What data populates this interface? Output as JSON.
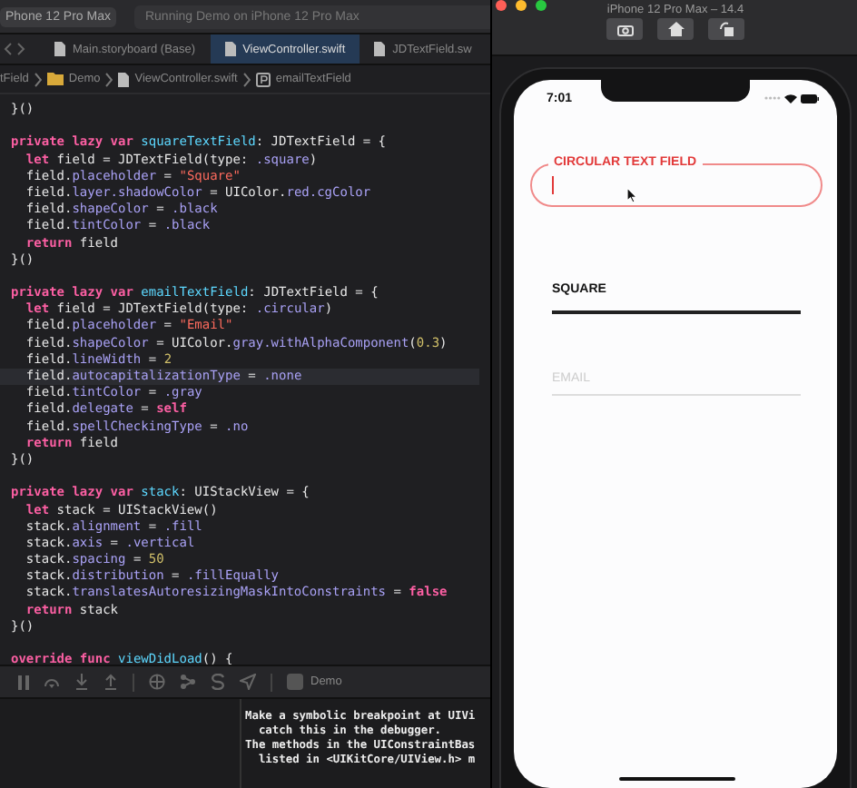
{
  "xcode": {
    "toolbar": {
      "scheme": "Phone 12 Pro Max",
      "status": "Running Demo on iPhone 12 Pro Max"
    },
    "tabs": [
      {
        "label": "Main.storyboard (Base)",
        "selected": false
      },
      {
        "label": "ViewController.swift",
        "selected": true
      },
      {
        "label": "JDTextField.sw",
        "selected": false
      }
    ],
    "breadcrumb": [
      {
        "label": "tField",
        "kind": "plain"
      },
      {
        "label": "Demo",
        "kind": "folder"
      },
      {
        "label": "ViewController.swift",
        "kind": "file"
      },
      {
        "label": "emailTextField",
        "kind": "property"
      }
    ],
    "code_blocks": [
      {
        "lines": [
          {
            "highlighted": false,
            "tokens": [
              {
                "text": "}()",
                "kind": "plain"
              }
            ]
          }
        ]
      },
      {
        "lines": [
          {
            "highlighted": false,
            "tokens": [
              {
                "text": "private lazy var ",
                "kind": "keyword"
              },
              {
                "text": "squareTextField",
                "kind": "name"
              },
              {
                "text": ": JDTextField = {",
                "kind": "plain"
              }
            ]
          },
          {
            "highlighted": false,
            "tokens": [
              {
                "text": "  let",
                "kind": "keyword"
              },
              {
                "text": " field = JDTextField(type: ",
                "kind": "plain"
              },
              {
                "text": ".square",
                "kind": "member"
              },
              {
                "text": ")",
                "kind": "plain"
              }
            ]
          },
          {
            "highlighted": false,
            "tokens": [
              {
                "text": "  field.",
                "kind": "plain"
              },
              {
                "text": "placeholder",
                "kind": "member"
              },
              {
                "text": " = ",
                "kind": "plain"
              },
              {
                "text": "\"Square\"",
                "kind": "string"
              }
            ]
          },
          {
            "highlighted": false,
            "tokens": [
              {
                "text": "  field.",
                "kind": "plain"
              },
              {
                "text": "layer.shadowColor",
                "kind": "member"
              },
              {
                "text": " = UIColor.",
                "kind": "plain"
              },
              {
                "text": "red.cgColor",
                "kind": "member"
              }
            ]
          },
          {
            "highlighted": false,
            "tokens": [
              {
                "text": "  field.",
                "kind": "plain"
              },
              {
                "text": "shapeColor",
                "kind": "member"
              },
              {
                "text": " = ",
                "kind": "plain"
              },
              {
                "text": ".black",
                "kind": "member"
              }
            ]
          },
          {
            "highlighted": false,
            "tokens": [
              {
                "text": "  field.",
                "kind": "plain"
              },
              {
                "text": "tintColor",
                "kind": "member"
              },
              {
                "text": " = ",
                "kind": "plain"
              },
              {
                "text": ".black",
                "kind": "member"
              }
            ]
          },
          {
            "highlighted": false,
            "tokens": [
              {
                "text": "  return",
                "kind": "keyword"
              },
              {
                "text": " field",
                "kind": "plain"
              }
            ]
          },
          {
            "highlighted": false,
            "tokens": [
              {
                "text": "}()",
                "kind": "plain"
              }
            ]
          }
        ]
      },
      {
        "lines": [
          {
            "highlighted": false,
            "tokens": [
              {
                "text": "private lazy var ",
                "kind": "keyword"
              },
              {
                "text": "emailTextField",
                "kind": "name"
              },
              {
                "text": ": JDTextField = {",
                "kind": "plain"
              }
            ]
          },
          {
            "highlighted": false,
            "tokens": [
              {
                "text": "  let",
                "kind": "keyword"
              },
              {
                "text": " field = JDTextField(type: ",
                "kind": "plain"
              },
              {
                "text": ".circular",
                "kind": "member"
              },
              {
                "text": ")",
                "kind": "plain"
              }
            ]
          },
          {
            "highlighted": false,
            "tokens": [
              {
                "text": "  field.",
                "kind": "plain"
              },
              {
                "text": "placeholder",
                "kind": "member"
              },
              {
                "text": " = ",
                "kind": "plain"
              },
              {
                "text": "\"Email\"",
                "kind": "string"
              }
            ]
          },
          {
            "highlighted": false,
            "tokens": [
              {
                "text": "  field.",
                "kind": "plain"
              },
              {
                "text": "shapeColor",
                "kind": "member"
              },
              {
                "text": " = UIColor.",
                "kind": "plain"
              },
              {
                "text": "gray.withAlphaComponent",
                "kind": "member"
              },
              {
                "text": "(",
                "kind": "plain"
              },
              {
                "text": "0.3",
                "kind": "number"
              },
              {
                "text": ")",
                "kind": "plain"
              }
            ]
          },
          {
            "highlighted": false,
            "tokens": [
              {
                "text": "  field.",
                "kind": "plain"
              },
              {
                "text": "lineWidth",
                "kind": "member"
              },
              {
                "text": " = ",
                "kind": "plain"
              },
              {
                "text": "2",
                "kind": "number"
              }
            ]
          },
          {
            "highlighted": true,
            "tokens": [
              {
                "text": "  field.",
                "kind": "plain"
              },
              {
                "text": "autocapitalizationType",
                "kind": "member"
              },
              {
                "text": " = ",
                "kind": "plain"
              },
              {
                "text": ".none",
                "kind": "member"
              }
            ]
          },
          {
            "highlighted": false,
            "tokens": [
              {
                "text": "  field.",
                "kind": "plain"
              },
              {
                "text": "tintColor",
                "kind": "member"
              },
              {
                "text": " = ",
                "kind": "plain"
              },
              {
                "text": ".gray",
                "kind": "member"
              }
            ]
          },
          {
            "highlighted": false,
            "tokens": [
              {
                "text": "  field.",
                "kind": "plain"
              },
              {
                "text": "delegate",
                "kind": "member"
              },
              {
                "text": " = ",
                "kind": "plain"
              },
              {
                "text": "self",
                "kind": "keyword"
              }
            ]
          },
          {
            "highlighted": false,
            "tokens": [
              {
                "text": "  field.",
                "kind": "plain"
              },
              {
                "text": "spellCheckingType",
                "kind": "member"
              },
              {
                "text": " = ",
                "kind": "plain"
              },
              {
                "text": ".no",
                "kind": "member"
              }
            ]
          },
          {
            "highlighted": false,
            "tokens": [
              {
                "text": "  return",
                "kind": "keyword"
              },
              {
                "text": " field",
                "kind": "plain"
              }
            ]
          },
          {
            "highlighted": false,
            "tokens": [
              {
                "text": "}()",
                "kind": "plain"
              }
            ]
          }
        ]
      },
      {
        "lines": [
          {
            "highlighted": false,
            "tokens": [
              {
                "text": "private lazy var ",
                "kind": "keyword"
              },
              {
                "text": "stack",
                "kind": "name"
              },
              {
                "text": ": UIStackView = {",
                "kind": "plain"
              }
            ]
          },
          {
            "highlighted": false,
            "tokens": [
              {
                "text": "  let",
                "kind": "keyword"
              },
              {
                "text": " stack = UIStackView()",
                "kind": "plain"
              }
            ]
          },
          {
            "highlighted": false,
            "tokens": [
              {
                "text": "  stack.",
                "kind": "plain"
              },
              {
                "text": "alignment",
                "kind": "member"
              },
              {
                "text": " = ",
                "kind": "plain"
              },
              {
                "text": ".fill",
                "kind": "member"
              }
            ]
          },
          {
            "highlighted": false,
            "tokens": [
              {
                "text": "  stack.",
                "kind": "plain"
              },
              {
                "text": "axis",
                "kind": "member"
              },
              {
                "text": " = ",
                "kind": "plain"
              },
              {
                "text": ".vertical",
                "kind": "member"
              }
            ]
          },
          {
            "highlighted": false,
            "tokens": [
              {
                "text": "  stack.",
                "kind": "plain"
              },
              {
                "text": "spacing",
                "kind": "member"
              },
              {
                "text": " = ",
                "kind": "plain"
              },
              {
                "text": "50",
                "kind": "number"
              }
            ]
          },
          {
            "highlighted": false,
            "tokens": [
              {
                "text": "  stack.",
                "kind": "plain"
              },
              {
                "text": "distribution",
                "kind": "member"
              },
              {
                "text": " = ",
                "kind": "plain"
              },
              {
                "text": ".fillEqually",
                "kind": "member"
              }
            ]
          },
          {
            "highlighted": false,
            "tokens": [
              {
                "text": "  stack.",
                "kind": "plain"
              },
              {
                "text": "translatesAutoresizingMaskIntoConstraints",
                "kind": "member"
              },
              {
                "text": " = ",
                "kind": "plain"
              },
              {
                "text": "false",
                "kind": "keyword"
              }
            ]
          },
          {
            "highlighted": false,
            "tokens": [
              {
                "text": "  return",
                "kind": "keyword"
              },
              {
                "text": " stack",
                "kind": "plain"
              }
            ]
          },
          {
            "highlighted": false,
            "tokens": [
              {
                "text": "}()",
                "kind": "plain"
              }
            ]
          }
        ]
      },
      {
        "lines": [
          {
            "highlighted": false,
            "tokens": [
              {
                "text": "override func ",
                "kind": "keyword"
              },
              {
                "text": "viewDidLoad",
                "kind": "name"
              },
              {
                "text": "() {",
                "kind": "plain"
              }
            ]
          }
        ]
      }
    ],
    "debug_bar": {
      "target": "Demo"
    },
    "console": [
      "Make a symbolic breakpoint at UIVi",
      "  catch this in the debugger.",
      "The methods in the UIConstraintBas",
      "  listed in <UIKitCore/UIView.h> m"
    ]
  },
  "simulator": {
    "title": "iPhone 12 Pro Max – 14.4",
    "time": "7:01",
    "fields": [
      {
        "kind": "circular",
        "label": "CIRCULAR TEXT FIELD",
        "focused": true
      },
      {
        "kind": "square",
        "label": "SQUARE",
        "focused": false
      },
      {
        "kind": "underline",
        "placeholder": "EMAIL",
        "focused": false
      }
    ]
  }
}
